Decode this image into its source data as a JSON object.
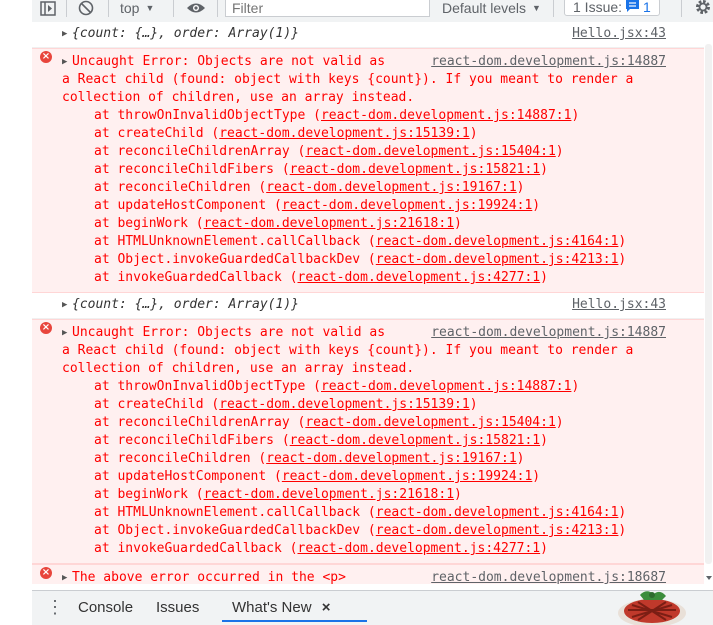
{
  "toolbar": {
    "context": "top",
    "filter_placeholder": "Filter",
    "levels": "Default levels",
    "issues_prefix": "1 Issue:",
    "issues_count": "1"
  },
  "console": {
    "log1": {
      "text": "{count: {…}, order: Array(1)}",
      "source": "Hello.jsx:43"
    },
    "error1": {
      "message": "Uncaught Error: Objects are not valid as  ",
      "source": "react-dom.development.js:14887",
      "continuation": "a React child (found: object with keys {count}). If you meant to render a\ncollection of children, use an array instead.",
      "frames": [
        {
          "fn": "at throwOnInvalidObjectType (",
          "loc": "react-dom.development.js:14887:1"
        },
        {
          "fn": "at createChild (",
          "loc": "react-dom.development.js:15139:1"
        },
        {
          "fn": "at reconcileChildrenArray (",
          "loc": "react-dom.development.js:15404:1"
        },
        {
          "fn": "at reconcileChildFibers (",
          "loc": "react-dom.development.js:15821:1"
        },
        {
          "fn": "at reconcileChildren (",
          "loc": "react-dom.development.js:19167:1"
        },
        {
          "fn": "at updateHostComponent (",
          "loc": "react-dom.development.js:19924:1"
        },
        {
          "fn": "at beginWork (",
          "loc": "react-dom.development.js:21618:1"
        },
        {
          "fn": "at HTMLUnknownElement.callCallback (",
          "loc": "react-dom.development.js:4164:1"
        },
        {
          "fn": "at Object.invokeGuardedCallbackDev (",
          "loc": "react-dom.development.js:4213:1"
        },
        {
          "fn": "at invokeGuardedCallback (",
          "loc": "react-dom.development.js:4277:1"
        }
      ]
    },
    "log2": {
      "text": "{count: {…}, order: Array(1)}",
      "source": "Hello.jsx:43"
    },
    "error2": {
      "message": "Uncaught Error: Objects are not valid as  ",
      "source": "react-dom.development.js:14887",
      "continuation": "a React child (found: object with keys {count}). If you meant to render a\ncollection of children, use an array instead.",
      "frames": [
        {
          "fn": "at throwOnInvalidObjectType (",
          "loc": "react-dom.development.js:14887:1"
        },
        {
          "fn": "at createChild (",
          "loc": "react-dom.development.js:15139:1"
        },
        {
          "fn": "at reconcileChildrenArray (",
          "loc": "react-dom.development.js:15404:1"
        },
        {
          "fn": "at reconcileChildFibers (",
          "loc": "react-dom.development.js:15821:1"
        },
        {
          "fn": "at reconcileChildren (",
          "loc": "react-dom.development.js:19167:1"
        },
        {
          "fn": "at updateHostComponent (",
          "loc": "react-dom.development.js:19924:1"
        },
        {
          "fn": "at beginWork (",
          "loc": "react-dom.development.js:21618:1"
        },
        {
          "fn": "at HTMLUnknownElement.callCallback (",
          "loc": "react-dom.development.js:4164:1"
        },
        {
          "fn": "at Object.invokeGuardedCallbackDev (",
          "loc": "react-dom.development.js:4213:1"
        },
        {
          "fn": "at invokeGuardedCallback (",
          "loc": "react-dom.development.js:4277:1"
        }
      ]
    },
    "error3": {
      "message": "The above error occurred in the <p>",
      "source": "react-dom.development.js:18687"
    }
  },
  "drawer": {
    "tabs": [
      {
        "label": "Console"
      },
      {
        "label": "Issues"
      },
      {
        "label": "What's New",
        "close": "×"
      }
    ]
  },
  "colors": {
    "error_text": "#ff0000",
    "error_bg": "#fff0f0",
    "accent": "#1a73e8",
    "toolbar_bg": "#f1f3f4"
  },
  "icons": [
    "show-sidebar-icon",
    "clear-console-icon",
    "eye-icon",
    "settings-gear-icon",
    "error-icon",
    "kebab-menu-icon",
    "close-icon",
    "mascot-illustration"
  ]
}
